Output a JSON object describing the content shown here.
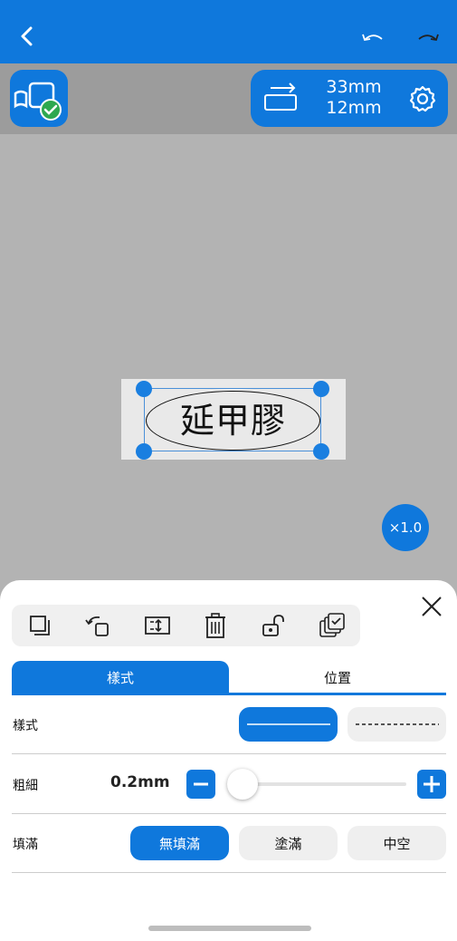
{
  "label_size": {
    "width": "33mm",
    "height": "12mm"
  },
  "canvas": {
    "label_text": "延甲膠",
    "zoom": "×1.0"
  },
  "tabs": [
    {
      "label": "樣式",
      "active": true
    },
    {
      "label": "位置",
      "active": false
    }
  ],
  "style_row": {
    "label": "樣式",
    "options": [
      "solid",
      "dashed"
    ],
    "selected": "solid"
  },
  "thickness_row": {
    "label": "粗細",
    "value": "0.2mm",
    "level": 0.08
  },
  "fill_row": {
    "label": "填滿",
    "options": [
      {
        "label": "無填滿",
        "active": true
      },
      {
        "label": "塗滿",
        "active": false
      },
      {
        "label": "中空",
        "active": false
      }
    ]
  },
  "colors": {
    "accent": "#0f78dc",
    "header_strip": "#9c9c9c",
    "canvas": "#b3b3b3"
  },
  "icons": [
    "back-icon",
    "undo-icon",
    "redo-icon",
    "printer-connected-icon",
    "orientation-icon",
    "gear-icon",
    "close-icon",
    "copy-icon",
    "rotate-icon",
    "fit-height-icon",
    "trash-icon",
    "lock-icon",
    "layers-icon"
  ]
}
